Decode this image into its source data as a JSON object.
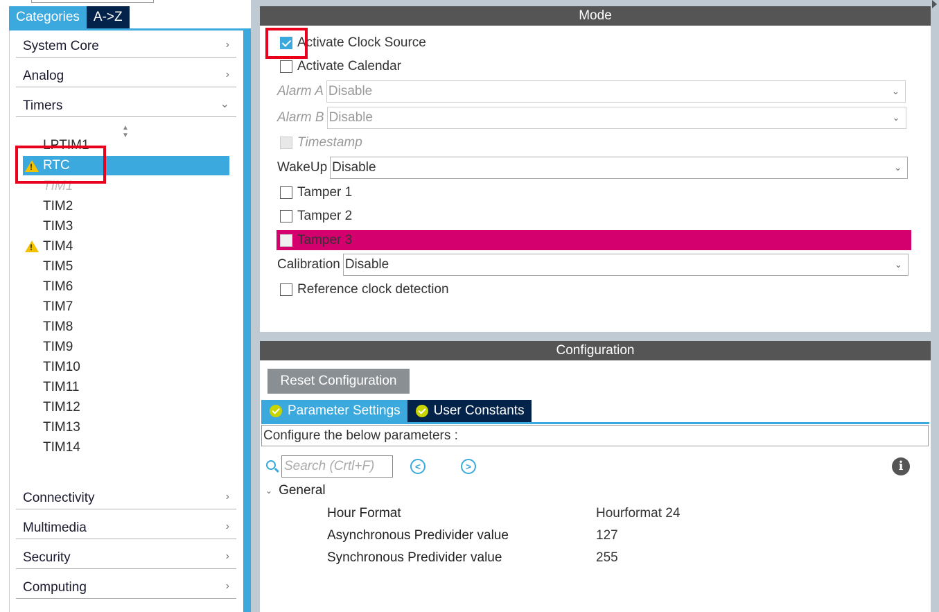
{
  "left": {
    "tabs": [
      "Categories",
      "A->Z"
    ],
    "categories_top": [
      {
        "label": "System Core",
        "chevron": "›"
      },
      {
        "label": "Analog",
        "chevron": "›"
      },
      {
        "label": "Timers",
        "chevron": "⌄"
      }
    ],
    "timers": [
      "LPTIM1",
      "RTC",
      "TIM1",
      "TIM2",
      "TIM3",
      "TIM4",
      "TIM5",
      "TIM6",
      "TIM7",
      "TIM8",
      "TIM9",
      "TIM10",
      "TIM11",
      "TIM12",
      "TIM13",
      "TIM14"
    ],
    "categories_bottom": [
      {
        "label": "Connectivity",
        "chevron": "›"
      },
      {
        "label": "Multimedia",
        "chevron": "›"
      },
      {
        "label": "Security",
        "chevron": "›"
      },
      {
        "label": "Computing",
        "chevron": "›"
      }
    ]
  },
  "mode": {
    "header": "Mode",
    "activate_clock_source": "Activate Clock Source",
    "activate_calendar": "Activate Calendar",
    "alarm_a_label": "Alarm A",
    "alarm_a_value": "Disable",
    "alarm_b_label": "Alarm B",
    "alarm_b_value": "Disable",
    "timestamp": "Timestamp",
    "wakeup_label": "WakeUp",
    "wakeup_value": "Disable",
    "tamper1": "Tamper 1",
    "tamper2": "Tamper 2",
    "tamper3": "Tamper 3",
    "calibration_label": "Calibration",
    "calibration_value": "Disable",
    "ref_clock": "Reference clock detection"
  },
  "config": {
    "header": "Configuration",
    "reset_button": "Reset Configuration",
    "tabs": [
      "Parameter Settings",
      "User Constants"
    ],
    "description": "Configure the below parameters :",
    "search_placeholder": "Search (Crtl+F)",
    "prev_icon": "<",
    "next_icon": ">",
    "info_icon": "i",
    "group": "General",
    "params": [
      {
        "name": "Hour Format",
        "value": "Hourformat 24"
      },
      {
        "name": "Asynchronous Predivider value",
        "value": "127"
      },
      {
        "name": "Synchronous Predivider value",
        "value": "255"
      }
    ]
  },
  "colors": {
    "accent": "#3ba9dd",
    "navy": "#03234b",
    "header": "#555555",
    "tamper_highlight": "#d4006e",
    "highlight_box": "#e8001c",
    "warning": "#f2c200"
  }
}
